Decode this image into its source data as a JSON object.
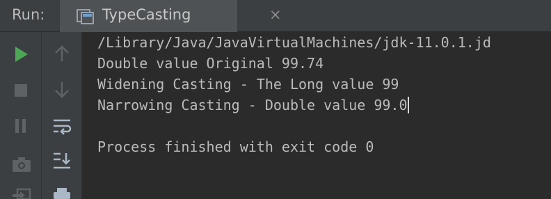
{
  "header": {
    "run_label": "Run:",
    "tab": {
      "label": "TypeCasting",
      "close": "×"
    }
  },
  "toolbar_left": [
    {
      "name": "run-icon",
      "color": "#4ca655"
    },
    {
      "name": "stop-icon"
    },
    {
      "name": "pause-icon"
    },
    {
      "name": "camera-icon"
    },
    {
      "name": "exit-icon"
    }
  ],
  "toolbar_right": [
    {
      "name": "up-arrow-icon"
    },
    {
      "name": "down-arrow-icon"
    },
    {
      "name": "soft-wrap-icon"
    },
    {
      "name": "scroll-to-end-icon"
    },
    {
      "name": "print-icon"
    }
  ],
  "console": {
    "lines": [
      "/Library/Java/JavaVirtualMachines/jdk-11.0.1.jd",
      "Double value Original 99.74",
      "Widening Casting - The Long value 99",
      "Narrowing Casting - Double value 99.0",
      "",
      "Process finished with exit code 0"
    ]
  }
}
